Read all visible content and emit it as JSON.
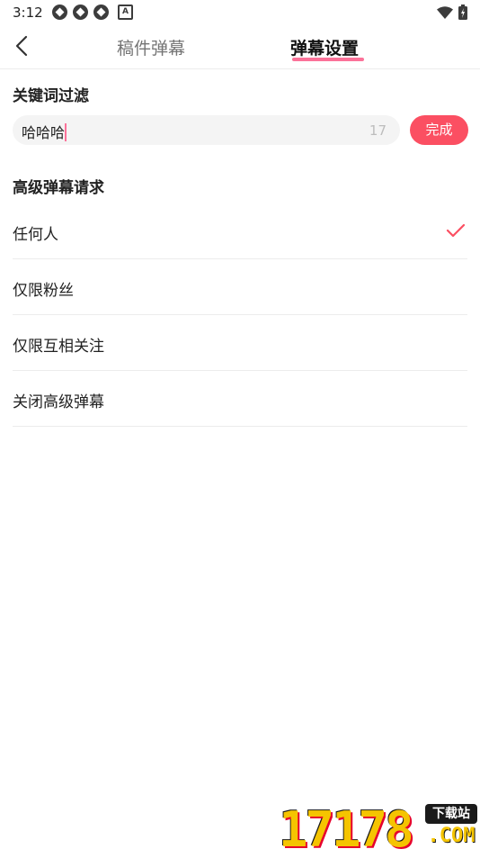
{
  "status_bar": {
    "time": "3:12",
    "a_badge": "A"
  },
  "header": {
    "tabs": [
      {
        "label": "稿件弹幕",
        "active": false
      },
      {
        "label": "弹幕设置",
        "active": true
      }
    ]
  },
  "keyword_filter": {
    "title": "关键词过滤",
    "input_value": "哈哈哈",
    "char_count": "17",
    "done_label": "完成"
  },
  "advanced_danmaku": {
    "title": "高级弹幕请求",
    "options": [
      {
        "label": "任何人",
        "selected": true
      },
      {
        "label": "仅限粉丝",
        "selected": false
      },
      {
        "label": "仅限互相关注",
        "selected": false
      },
      {
        "label": "关闭高级弹幕",
        "selected": false
      }
    ]
  },
  "watermark": {
    "digits": "17178",
    "tag": "下载站",
    "suffix": ".COM"
  },
  "colors": {
    "accent": "#fb4f62",
    "tab_underline": "#fb7299",
    "divider": "#ececec"
  }
}
